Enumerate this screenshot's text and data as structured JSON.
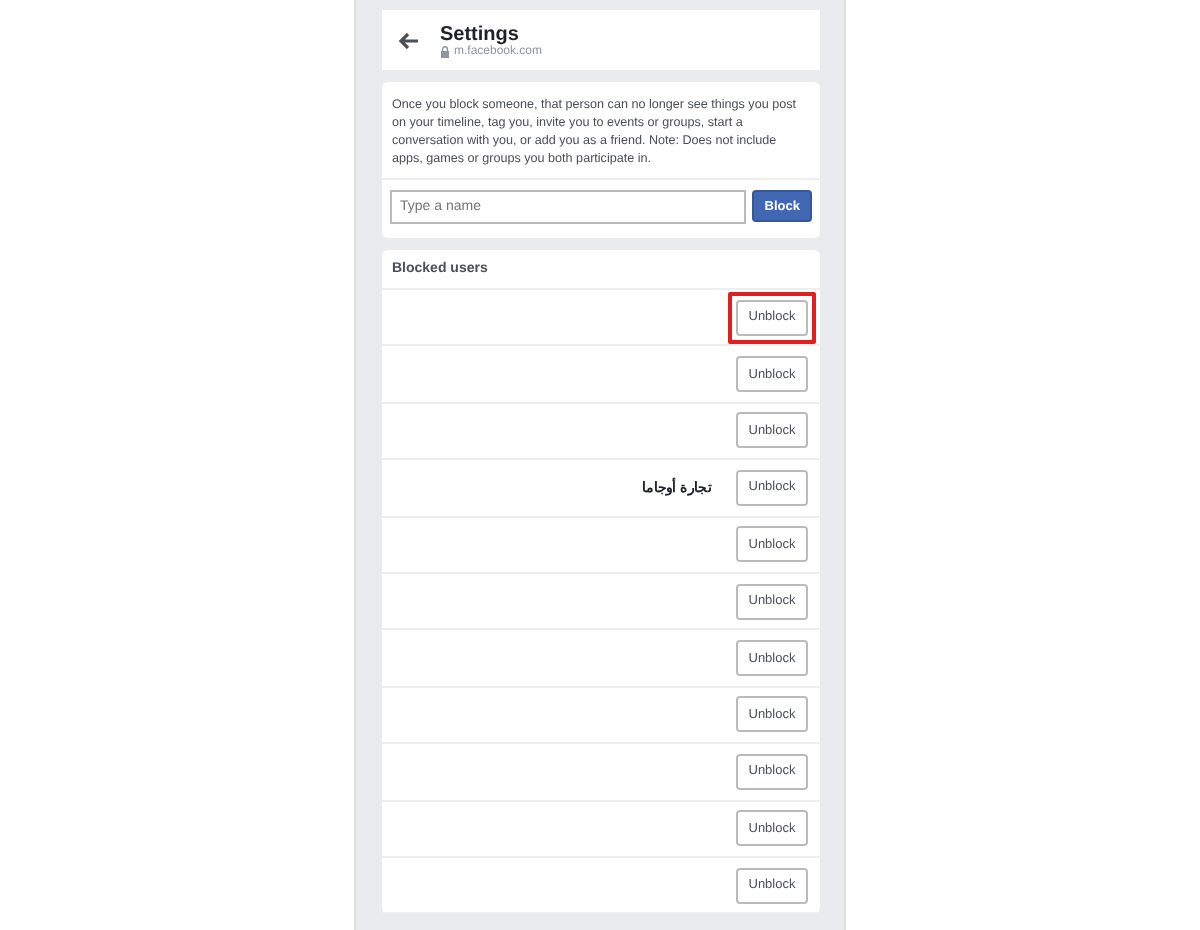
{
  "header": {
    "title": "Settings",
    "url": "m.facebook.com"
  },
  "block_panel": {
    "description": "Once you block someone, that person can no longer see things you post on your timeline, tag you, invite you to events or groups, start a conversation with you, or add you as a friend. Note: Does not include apps, games or groups you both participate in.",
    "placeholder": "Type a name",
    "button": "Block"
  },
  "blocked_users": {
    "title": "Blocked users",
    "rows": [
      {
        "button": "Unblock",
        "highlighted": true
      },
      {
        "button": "Unblock",
        "highlighted": false
      },
      {
        "button": "Unblock",
        "highlighted": false
      },
      {
        "name": "تجارة أوجاما",
        "button": "Unblock",
        "highlighted": false
      },
      {
        "button": "Unblock",
        "highlighted": false
      },
      {
        "button": "Unblock",
        "highlighted": false
      },
      {
        "button": "Unblock",
        "highlighted": false
      },
      {
        "button": "Unblock",
        "highlighted": false
      },
      {
        "button": "Unblock",
        "highlighted": false
      },
      {
        "button": "Unblock",
        "highlighted": false
      },
      {
        "button": "Unblock",
        "highlighted": false
      }
    ]
  }
}
